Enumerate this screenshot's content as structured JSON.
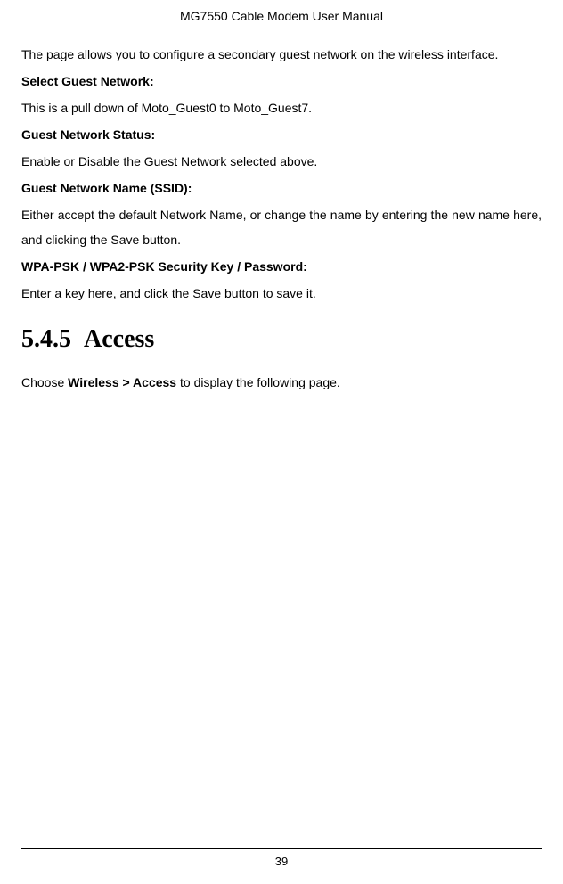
{
  "header": {
    "title": "MG7550 Cable Modem User Manual"
  },
  "intro": "The page allows you to configure a secondary guest network on the wireless interface.",
  "items": [
    {
      "label": "Select Guest Network:",
      "desc": "This is a pull down of Moto_Guest0 to Moto_Guest7."
    },
    {
      "label": "Guest Network Status:",
      "desc": "Enable or Disable the Guest Network selected above."
    },
    {
      "label": "Guest Network Name (SSID):",
      "desc": "Either accept the default Network Name, or change the name by entering the new name here, and clicking the Save button."
    },
    {
      "label": "WPA-PSK / WPA2-PSK Security Key / Password:",
      "desc": "Enter a key here, and click the Save button to save it."
    }
  ],
  "section": {
    "number": "5.4.5",
    "title": "Access",
    "instruction_prefix": "Choose ",
    "instruction_bold": "Wireless > Access",
    "instruction_suffix": " to display the following page."
  },
  "footer": {
    "page_number": "39"
  }
}
